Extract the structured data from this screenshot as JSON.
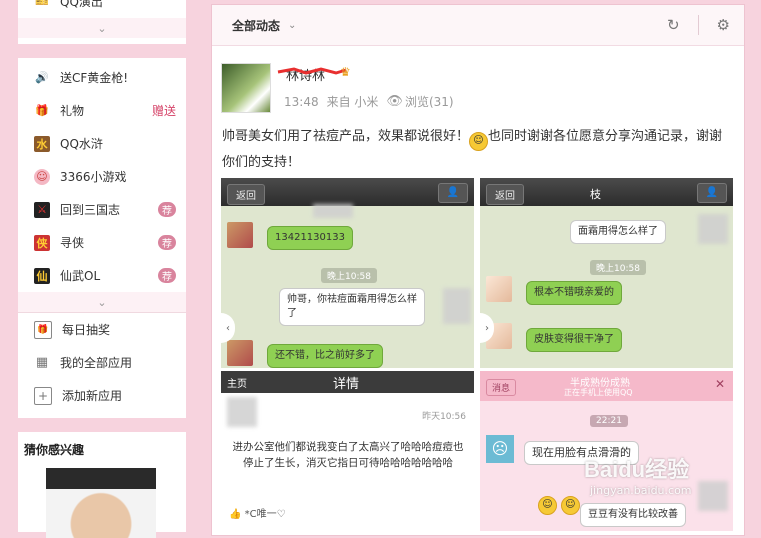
{
  "left_top": {
    "item_label": "QQ演出"
  },
  "apps": [
    {
      "label": "送CF黄金枪!",
      "icon": "speaker-icon",
      "tag": "",
      "badge": ""
    },
    {
      "label": "礼物",
      "icon": "gift-icon",
      "tag": "赠送",
      "badge": ""
    },
    {
      "label": "QQ水浒",
      "icon": "qq-shuihu-icon",
      "tag": "",
      "badge": ""
    },
    {
      "label": "3366小游戏",
      "icon": "game-3366-icon",
      "tag": "",
      "badge": ""
    },
    {
      "label": "回到三国志",
      "icon": "sword-icon",
      "tag": "",
      "badge": "荐"
    },
    {
      "label": "寻侠",
      "icon": "xunxia-icon",
      "tag": "",
      "badge": "荐"
    },
    {
      "label": "仙武OL",
      "icon": "xianwu-icon",
      "tag": "",
      "badge": "荐"
    }
  ],
  "tools": [
    {
      "label": "每日抽奖",
      "icon": "gift-outline-icon"
    },
    {
      "label": "我的全部应用",
      "icon": "grid-icon"
    },
    {
      "label": "添加新应用",
      "icon": "plus-box-icon"
    }
  ],
  "interest": {
    "title": "猜你感兴趣"
  },
  "feed": {
    "filter_label": "全部动态",
    "post": {
      "author": "林诗林",
      "time": "13:48",
      "source": "来自 小米",
      "views": "浏览(31)",
      "text_part1": "帅哥美女们用了祛痘产品，效果都说很好！",
      "text_part2": "也同时谢谢各位愿意分享沟通记录，谢谢你们的支持！"
    },
    "shots": {
      "s1": {
        "back": "返回",
        "msg1": "13421130133",
        "time": "晚上10:58",
        "msg2": "帅哥，你祛痘面霜用得怎么样了",
        "msg3": "还不错，比之前好多了"
      },
      "s2": {
        "back": "返回",
        "name": "枝",
        "msg1": "面霜用得怎么样了",
        "time": "晚上10:58",
        "msg2": "根本不错哦亲爱的",
        "msg3": "皮肤变得很干净了"
      },
      "s3": {
        "header_left": "主页",
        "header_title": "详情",
        "time": "昨天10:56",
        "body": "进办公室他们都说我变白了太高兴了哈哈哈痘痘也停止了生长，消灭它指日可待哈哈哈哈哈哈哈",
        "footer": "*C唯一♡"
      },
      "s4": {
        "back": "消息",
        "status1": "半成熟份成熟",
        "status2": "正在手机上使用QQ",
        "time": "22:21",
        "msg1": "现在用脸有点滑滑的",
        "msg2": "豆豆有没有比较改善"
      }
    }
  },
  "watermark": {
    "brand": "Baidu经验",
    "url": "jingyan.baidu.com"
  },
  "colors": {
    "page_bg": "#f7d3de",
    "accent": "#d6456a",
    "badge": "#d9849d"
  }
}
